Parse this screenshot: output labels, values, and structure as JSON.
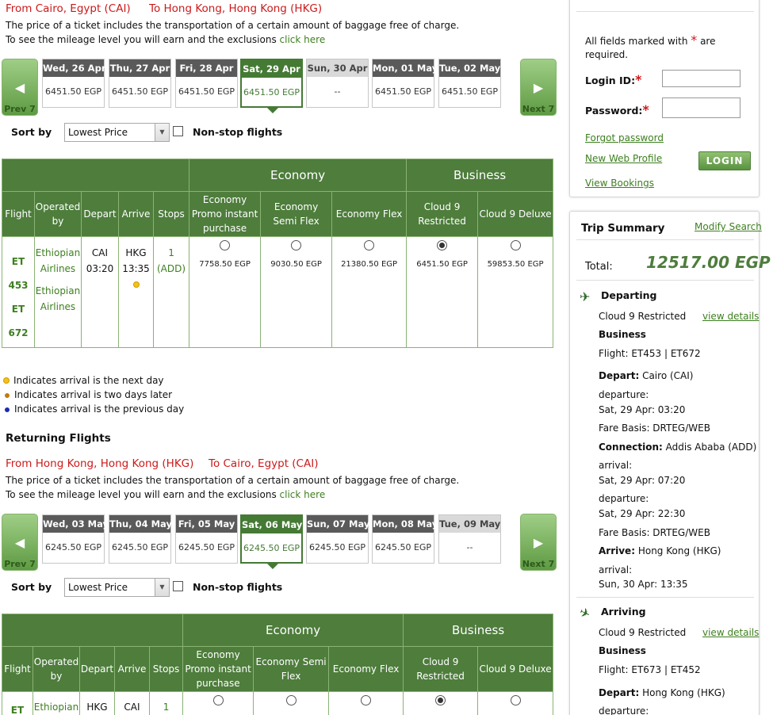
{
  "outbound": {
    "from": "From Cairo, Egypt (CAI)",
    "to": "To Hong Kong, Hong Kong (HKG)",
    "baggage_note": "The price of a ticket includes the transportation of a certain amount of baggage free of charge.",
    "mileage_note": "To see the mileage level you will earn and the exclusions",
    "click_here": "click here",
    "prev": "Prev 7",
    "next": "Next 7",
    "dates": [
      {
        "day": "Wed, 26 Apr",
        "price": "6451.50 EGP"
      },
      {
        "day": "Thu, 27 Apr",
        "price": "6451.50 EGP"
      },
      {
        "day": "Fri, 28 Apr",
        "price": "6451.50 EGP"
      },
      {
        "day": "Sat, 29 Apr",
        "price": "6451.50 EGP"
      },
      {
        "day": "Sun, 30 Apr",
        "price": "--"
      },
      {
        "day": "Mon, 01 May",
        "price": "6451.50 EGP"
      },
      {
        "day": "Tue, 02 May",
        "price": "6451.50 EGP"
      }
    ],
    "sort_label": "Sort by",
    "sort_value": "Lowest Price",
    "nonstop_label": "Non-stop flights",
    "cabins": {
      "economy": "Economy",
      "business": "Business"
    },
    "columns": [
      "Flight",
      "Operated by",
      "Depart",
      "Arrive",
      "Stops",
      "Economy Promo instant purchase",
      "Economy Semi Flex",
      "Economy Flex",
      "Cloud 9 Restricted",
      "Cloud 9 Deluxe"
    ],
    "row": {
      "flight1_a": "ET",
      "flight1_b": "453",
      "flight2_a": "ET",
      "flight2_b": "672",
      "op1": "Ethiopian Airlines",
      "op2": "Ethiopian Airlines",
      "dep_code": "CAI",
      "dep_time": "03:20",
      "arr_code": "HKG",
      "arr_time": "13:35",
      "stops": "1",
      "stops_via": "(ADD)",
      "fares": [
        "7758.50 EGP",
        "9030.50 EGP",
        "21380.50 EGP",
        "6451.50 EGP",
        "59853.50 EGP"
      ]
    }
  },
  "legend": {
    "next_day": "Indicates arrival is the next day",
    "two_days": "Indicates arrival is two days later",
    "prev_day": "Indicates arrival is the previous day"
  },
  "returning": {
    "heading": "Returning Flights",
    "from": "From Hong Kong, Hong Kong (HKG)",
    "to": "To Cairo, Egypt (CAI)",
    "baggage_note": "The price of a ticket includes the transportation of a certain amount of baggage free of charge.",
    "mileage_note": "To see the mileage level you will earn and the exclusions",
    "click_here": "click here",
    "prev": "Prev 7",
    "next": "Next 7",
    "dates": [
      {
        "day": "Wed, 03 May",
        "price": "6245.50 EGP"
      },
      {
        "day": "Thu, 04 May",
        "price": "6245.50 EGP"
      },
      {
        "day": "Fri, 05 May",
        "price": "6245.50 EGP"
      },
      {
        "day": "Sat, 06 May",
        "price": "6245.50 EGP"
      },
      {
        "day": "Sun, 07 May",
        "price": "6245.50 EGP"
      },
      {
        "day": "Mon, 08 May",
        "price": "6245.50 EGP"
      },
      {
        "day": "Tue, 09 May",
        "price": "--"
      }
    ],
    "sort_label": "Sort by",
    "sort_value": "Lowest Price",
    "nonstop_label": "Non-stop flights",
    "cabins": {
      "economy": "Economy",
      "business": "Business"
    },
    "columns": [
      "Flight",
      "Operated by",
      "Depart",
      "Arrive",
      "Stops",
      "Economy Promo instant purchase",
      "Economy Semi Flex",
      "Economy Flex",
      "Cloud 9 Restricted",
      "Cloud 9 Deluxe"
    ],
    "row": {
      "flight_a": "ET",
      "op": "Ethiopian",
      "dep_code": "HKG",
      "arr_code": "CAI",
      "stops": "1"
    }
  },
  "login": {
    "required_note_a": "All fields marked with",
    "required_star": "*",
    "required_note_b": "are",
    "required_note_c": "required.",
    "login_id": "Login ID:",
    "password": "Password:",
    "forgot": "Forgot password",
    "new_profile": "New Web Profile",
    "view_bookings": "View Bookings",
    "login_button": "LOGIN"
  },
  "trip": {
    "title": "Trip Summary",
    "modify": "Modify Search",
    "total_label": "Total:",
    "total_value": "12517.00 EGP",
    "departing": {
      "label": "Departing",
      "fare_name": "Cloud 9 Restricted",
      "view_details": "view details",
      "cabin": "Business",
      "flight": "Flight: ET453 | ET672",
      "depart_label": "Depart:",
      "depart_city": "Cairo (CAI)",
      "departure_label": "departure:",
      "departure_time": "Sat, 29 Apr: 03:20",
      "fare_basis": "Fare Basis: DRTEG/WEB",
      "connection_label": "Connection:",
      "connection_city": "Addis Ababa (ADD)",
      "arrival_label": "arrival:",
      "conn_arrival": "Sat, 29 Apr: 07:20",
      "departure_label2": "departure:",
      "conn_departure": "Sat, 29 Apr: 22:30",
      "fare_basis2": "Fare Basis: DRTEG/WEB",
      "arrive_label": "Arrive:",
      "arrive_city": "Hong Kong (HKG)",
      "arrival_label2": "arrival:",
      "arrival_time": "Sun, 30 Apr: 13:35"
    },
    "arriving": {
      "label": "Arriving",
      "fare_name": "Cloud 9 Restricted",
      "view_details": "view details",
      "cabin": "Business",
      "flight": "Flight: ET673 | ET452",
      "depart_label": "Depart:",
      "depart_city": "Hong Kong (HKG)",
      "departure_label": "departure:"
    }
  },
  "colors": {
    "brand_green": "#4e7d3c",
    "link_green": "#3d7f1f",
    "alert_red": "#cc1a1a",
    "total_green": "#4e7d3c"
  },
  "icons": [
    "prev-arrow-icon",
    "next-arrow-icon",
    "plane-depart-icon",
    "plane-arrive-icon",
    "next-day-dot-icon",
    "two-days-dot-icon",
    "prev-day-dot-icon"
  ]
}
